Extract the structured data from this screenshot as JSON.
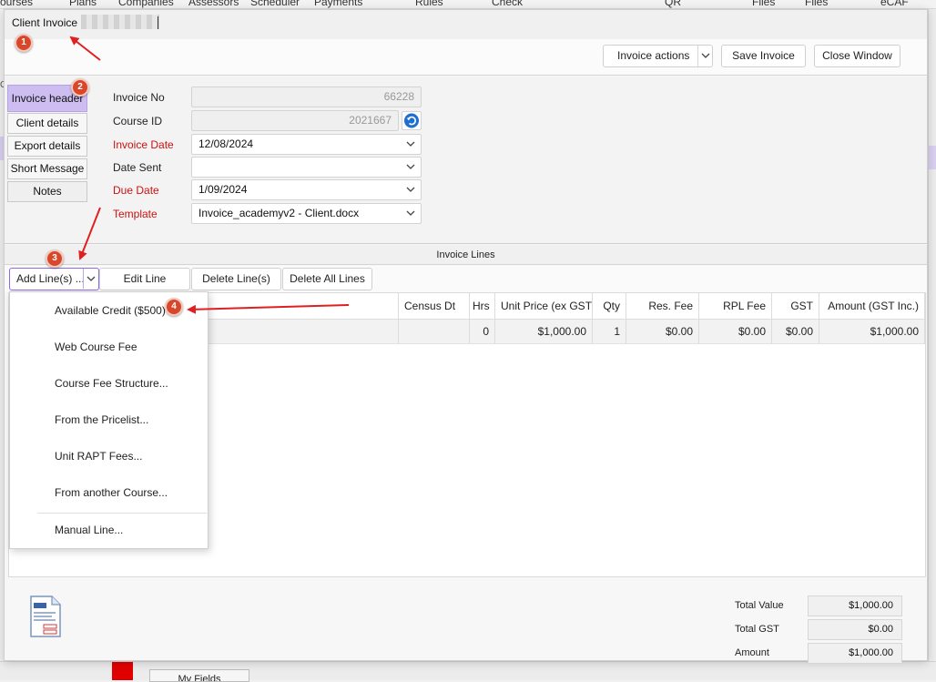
{
  "background": {
    "menu_items": [
      "ourses",
      "Plans",
      "Companies",
      "Assessors",
      "Scheduler",
      "Payments",
      "Rules",
      "Check",
      "QR",
      "Files",
      "Files",
      "eCAF"
    ],
    "left_edge_text": "Gr",
    "bottom_tab": "My Fields"
  },
  "window": {
    "title": "Client Invoice"
  },
  "toolbar": {
    "invoice_actions": "Invoice actions",
    "save_invoice": "Save Invoice",
    "close_window": "Close Window"
  },
  "tabs": [
    "Invoice header",
    "Client details",
    "Export details",
    "Short Message",
    "Notes"
  ],
  "header": {
    "invoice_no_label": "Invoice No",
    "invoice_no": "66228",
    "course_id_label": "Course ID",
    "course_id": "2021667",
    "invoice_date_label": "Invoice Date",
    "invoice_date": "12/08/2024",
    "date_sent_label": "Date Sent",
    "date_sent": "",
    "due_date_label": "Due Date",
    "due_date": "1/09/2024",
    "template_label": "Template",
    "template": "Invoice_academyv2 - Client.docx"
  },
  "lines": {
    "section_title": "Invoice Lines",
    "add_lines": "Add Line(s) ...",
    "edit_line": "Edit Line",
    "delete_lines": "Delete Line(s)",
    "delete_all": "Delete All Lines",
    "columns": [
      "Census Dt",
      "Hrs",
      "Unit Price (ex GST)",
      "Qty",
      "Res. Fee",
      "RPL Fee",
      "GST",
      "Amount (GST Inc.)"
    ],
    "rows": [
      {
        "census": "",
        "hrs": "0",
        "unit_price": "$1,000.00",
        "qty": "1",
        "res_fee": "$0.00",
        "rpl_fee": "$0.00",
        "gst": "$0.00",
        "amount": "$1,000.00"
      }
    ]
  },
  "add_menu": [
    "Available Credit ($500)",
    "Web Course Fee",
    "Course Fee Structure...",
    "From the Pricelist...",
    "Unit RAPT Fees...",
    "From another Course...",
    "Manual Line..."
  ],
  "totals": {
    "total_value_label": "Total Value",
    "total_value": "$1,000.00",
    "total_gst_label": "Total GST",
    "total_gst": "$0.00",
    "amount_label": "Amount",
    "amount": "$1,000.00"
  },
  "annotations": [
    "1",
    "2",
    "3",
    "4"
  ],
  "colors": {
    "annotation": "#d9472b",
    "arrow": "#e02020",
    "active_tab": "#cdbdf0",
    "required_label": "#cc1111"
  }
}
